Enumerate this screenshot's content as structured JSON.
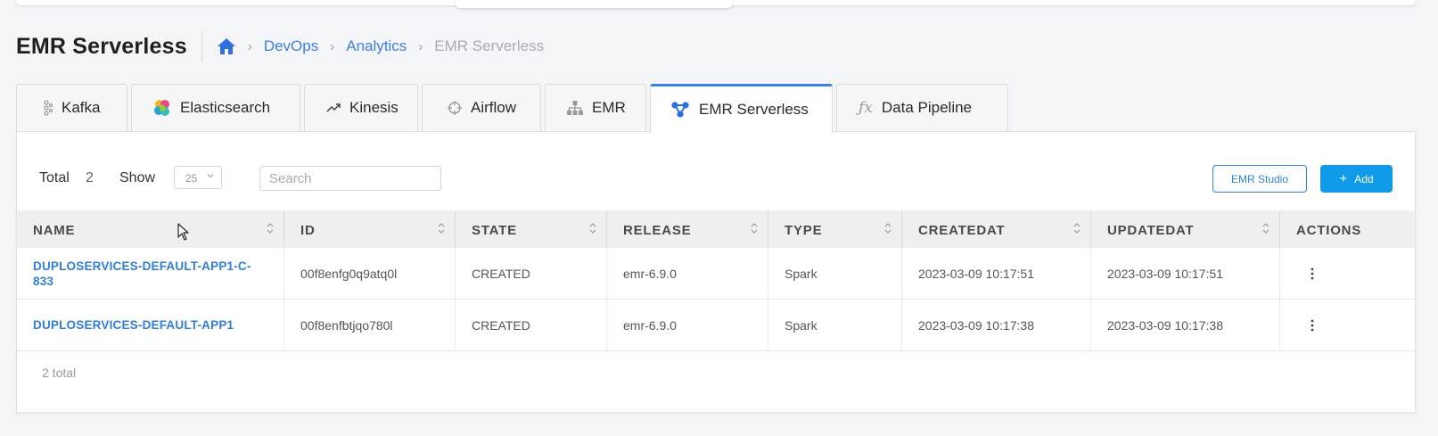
{
  "header": {
    "title": "EMR Serverless",
    "breadcrumb": {
      "home_icon": "home-icon",
      "items": [
        "DevOps",
        "Analytics"
      ],
      "current": "EMR Serverless"
    }
  },
  "tabs": [
    {
      "label": "Kafka",
      "icon": "kafka-icon"
    },
    {
      "label": "Elasticsearch",
      "icon": "elasticsearch-icon"
    },
    {
      "label": "Kinesis",
      "icon": "trend-icon"
    },
    {
      "label": "Airflow",
      "icon": "airflow-icon"
    },
    {
      "label": "EMR",
      "icon": "hierarchy-icon"
    },
    {
      "label": "EMR Serverless",
      "icon": "emr-serverless-icon",
      "active": true
    },
    {
      "label": "Data Pipeline",
      "icon": "function-icon"
    }
  ],
  "toolbar": {
    "total_label": "Total",
    "total_count": "2",
    "show_label": "Show",
    "page_size": "25",
    "search_placeholder": "Search",
    "emr_studio_label": "EMR Studio",
    "add_label": "Add"
  },
  "table": {
    "columns": [
      "NAME",
      "ID",
      "STATE",
      "RELEASE",
      "TYPE",
      "CREATEDAT",
      "UPDATEDAT",
      "ACTIONS"
    ],
    "rows": [
      {
        "name_line1": "DUPLOSERVICES-DEFAULT-APP1-C-",
        "name_line2": "833",
        "id": "00f8enfg0q9atq0l",
        "state": "CREATED",
        "release": "emr-6.9.0",
        "type": "Spark",
        "createdat": "2023-03-09 10:17:51",
        "updatedat": "2023-03-09 10:17:51"
      },
      {
        "name_line1": "DUPLOSERVICES-DEFAULT-APP1",
        "name_line2": "",
        "id": "00f8enfbtjqo780l",
        "state": "CREATED",
        "release": "emr-6.9.0",
        "type": "Spark",
        "createdat": "2023-03-09 10:17:38",
        "updatedat": "2023-03-09 10:17:38"
      }
    ]
  },
  "footer": {
    "total_text": "2 total"
  },
  "colors": {
    "link": "#2f7ed8",
    "primary_button": "#109be8",
    "active_tab": "#3b82e6"
  }
}
